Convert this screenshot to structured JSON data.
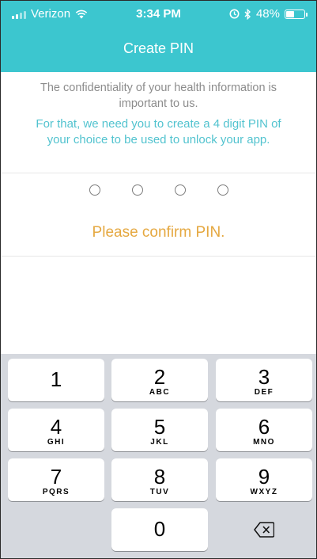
{
  "status_bar": {
    "carrier": "Verizon",
    "time": "3:34 PM",
    "battery_percent": "48%",
    "battery_level": 0.48
  },
  "header": {
    "title": "Create PIN"
  },
  "info": {
    "confidentiality": "The confidentiality of your health information is important to us.",
    "instruction": "For that, we need you to create a 4 digit PIN of your choice to be used to unlock your app."
  },
  "pin": {
    "length": 4,
    "filled": 0,
    "prompt": "Please confirm PIN."
  },
  "keypad": {
    "keys": [
      {
        "num": "1",
        "letters": ""
      },
      {
        "num": "2",
        "letters": "ABC"
      },
      {
        "num": "3",
        "letters": "DEF"
      },
      {
        "num": "4",
        "letters": "GHI"
      },
      {
        "num": "5",
        "letters": "JKL"
      },
      {
        "num": "6",
        "letters": "MNO"
      },
      {
        "num": "7",
        "letters": "PQRS"
      },
      {
        "num": "8",
        "letters": "TUV"
      },
      {
        "num": "9",
        "letters": "WXYZ"
      },
      {
        "num": "0",
        "letters": ""
      }
    ]
  },
  "colors": {
    "header": "#3cc6cf",
    "instruction_text": "#52c3cf",
    "prompt_text": "#e5a840",
    "keypad_background": "#d5d8de"
  },
  "icons": {
    "wifi": "wifi-icon",
    "signal": "signal-bars-icon",
    "alarm": "alarm-icon",
    "bluetooth": "bluetooth-icon",
    "battery": "battery-icon",
    "backspace": "backspace-icon"
  }
}
